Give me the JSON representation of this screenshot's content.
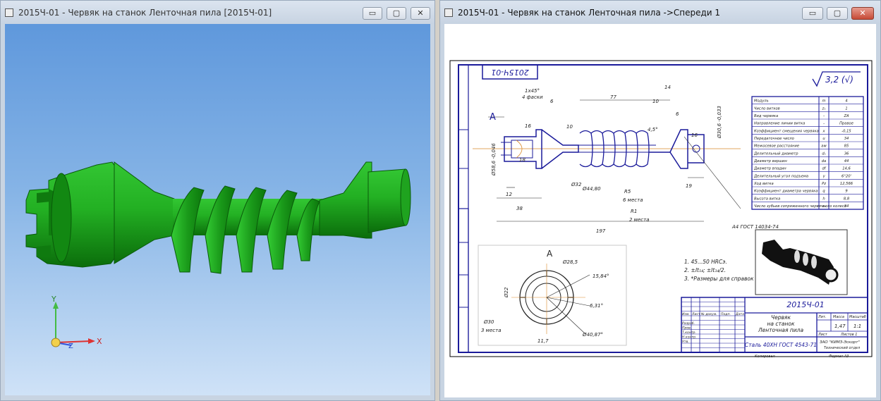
{
  "left_window": {
    "title": "2015Ч-01 - Червяк на станок Ленточная пила [2015Ч-01]",
    "buttons": {
      "minimize": "▭",
      "maximize": "▢",
      "close": "✕"
    },
    "axes": {
      "x": "X",
      "y": "Y",
      "z": "Z"
    }
  },
  "right_window": {
    "title": "2015Ч-01 - Червяк на станок Ленточная пила ->Спереди 1",
    "buttons": {
      "minimize": "▭",
      "maximize": "▢",
      "close": "✕"
    }
  },
  "drawing": {
    "stamp_code": "2015Ч-01",
    "roughness": "3,2 (√)",
    "view_label": "A",
    "dimensions": {
      "chamfer": "1х45°",
      "chamfer_note": "4 фаски",
      "d6a": "6",
      "d77": "77",
      "d14": "14",
      "d10a": "10",
      "d6b": "6",
      "d10b": "10",
      "r16a": "16",
      "r16b": "16",
      "d18": "18",
      "d12": "12",
      "d38": "38",
      "d197": "197",
      "d19": "19",
      "d32": "Ø32",
      "d44": "Ø44,80",
      "r5": "R5",
      "r5_note": "6 места",
      "r1": "R1",
      "r1_note": "2 места",
      "ang": "4,5°",
      "left_dia": "Ø58,6 -0,046",
      "right_dia": "Ø30,6 -0,033",
      "gost_center": "А4 ГОСТ 14034-74"
    },
    "notes": [
      "1. 45...50 HRCэ.",
      "2. ±It₁₄; ±It₁₄/2.",
      "3. *Размеры для справок"
    ],
    "view_a": {
      "d28": "Ø28,5",
      "a15": "15,84°",
      "d22": "Ø22",
      "a6": "6,31°",
      "d30": "Ø30",
      "note30": "3 места",
      "d11": "11,7",
      "d40": "Ø40,87°"
    },
    "table": [
      {
        "n": "Модуль",
        "s": "m",
        "v": "4"
      },
      {
        "n": "Число витков",
        "s": "z₁",
        "v": "1"
      },
      {
        "n": "Вид червяка",
        "s": "-",
        "v": "ZA"
      },
      {
        "n": "Направление линии витка",
        "s": "-",
        "v": "Правое"
      },
      {
        "n": "Коэффициент смещения червяка",
        "s": "x",
        "v": "-0,15"
      },
      {
        "n": "Передаточное число",
        "s": "u",
        "v": "34"
      },
      {
        "n": "Межосевое расстояние",
        "s": "aw",
        "v": "85"
      },
      {
        "n": "Делительный диаметр",
        "s": "d₁",
        "v": "36"
      },
      {
        "n": "Диаметр вершин",
        "s": "da",
        "v": "44"
      },
      {
        "n": "Диаметр впадин",
        "s": "df",
        "v": "14,6"
      },
      {
        "n": "Делительный угол подъема",
        "s": "γ",
        "v": "6°20'"
      },
      {
        "n": "Ход витка",
        "s": "Pz",
        "v": "12,566"
      },
      {
        "n": "Коэффициент диаметра червяка",
        "s": "q",
        "v": "9"
      },
      {
        "n": "Высота витка",
        "s": "h",
        "v": "8,8"
      },
      {
        "n": "Число зубьев сопряженного червячного колеса",
        "s": "z₂",
        "v": "34"
      }
    ],
    "stamp": {
      "name_line1": "Червяк",
      "name_line2": "на станок",
      "name_line3": "Ленточная пила",
      "material": "Сталь 40ХН ГОСТ 4543-71",
      "lit": "Лит.",
      "mass": "Масса",
      "scale": "Масштаб",
      "mass_value": "1,47",
      "scale_value": "1:1",
      "sheet": "Лист",
      "sheets": "Листов 1",
      "org": "ЗАО \"КИМЗ-Эскорт\"",
      "org2": "Технический отдел",
      "copied": "Копировал",
      "format": "Формат А3",
      "rows": [
        "Изм.",
        "Лист",
        "№ докум.",
        "Подп.",
        "Дата",
        "Разраб.",
        "Пров.",
        "Т.контр.",
        "Н.контр.",
        "Утв."
      ]
    }
  }
}
